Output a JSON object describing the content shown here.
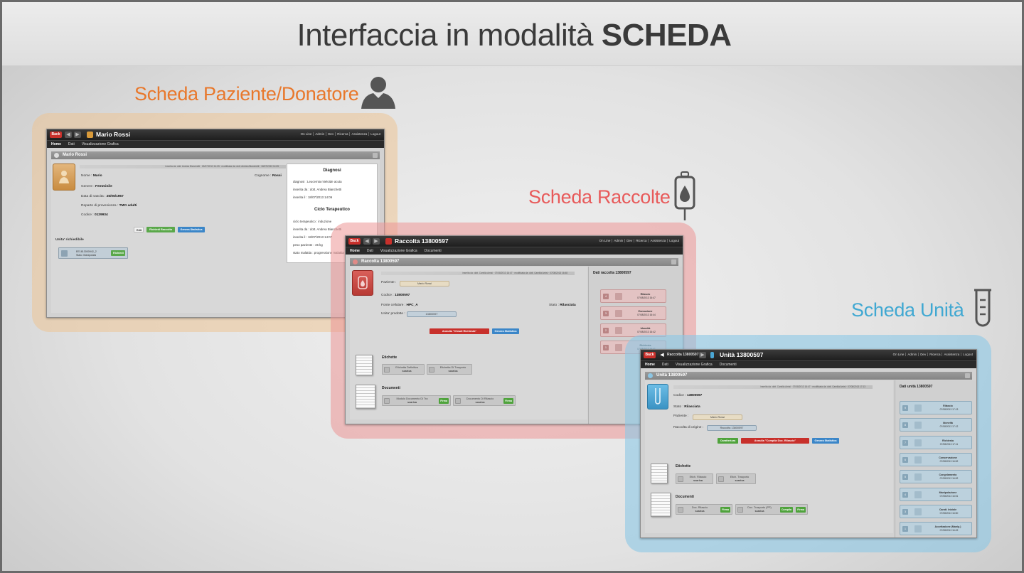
{
  "title": {
    "prefix": "Interfaccia in modalità",
    "bold": "SCHEDA"
  },
  "colors": {
    "paziente": "#e8782c",
    "raccolte": "#e85a5a",
    "unita": "#40a8d2"
  },
  "icons": {
    "paziente": "person-icon",
    "raccolte": "blood-bag-icon",
    "unita": "test-tube-icon"
  },
  "common": {
    "back": "Back",
    "top_menu": [
      "On Line",
      "Admin",
      "Dev",
      "Ricerca",
      "Assistenza",
      "Logout"
    ],
    "tabs": [
      "Home",
      "Dati",
      "Visualizzazione Grafica",
      "Documenti"
    ]
  },
  "paziente": {
    "label": "Scheda Paziente/Donatore",
    "title": "Mario Rossi",
    "header": "Mario Rossi",
    "meta": "inserita da: dott. Andrea Bianchetti · 18/07/2013 14:05 · modificata da: dott. Andrea Bianchetti · 18/07/2013 14:05",
    "nome_label": "Nome :",
    "nome": "Mario",
    "cognome_label": "Cognome :",
    "cognome": "Rossi",
    "genere_label": "Genere :",
    "genere": "Femminile",
    "nascita_label": "Data di nascita :",
    "nascita": "25/06/1967",
    "reparto_label": "Reparto di provenienza :",
    "reparto": "TMO adulti",
    "codice_label": "Codice :",
    "codice": "0129934",
    "btn_edit": "Edit",
    "btn_richiedi": "Richiedi Raccolta",
    "btn_genera": "Genera Statistica",
    "unita_title": "Unita' richiedibile",
    "unita_code": "EE1813000942_2",
    "unita_stato": "Stato: Manipolata",
    "unita_btn": "Richiedi",
    "diagnosi": {
      "title": "Diagnosi",
      "rows": [
        "diagnosi : Leucemia mieloide acuta",
        "inserita da : dott. Andrea Bianchetti",
        "inserita il : 18/07/2013 14:06"
      ]
    },
    "ciclo": {
      "title": "Ciclo Terapeutico",
      "rows": [
        "ciclo terapeutico : induzione",
        "inserita da : dott. Andrea Bianchetti",
        "inserita il : 18/07/2013 14:07",
        "peso paziente : 45 kg",
        "stato malattia : progressione malattia"
      ]
    }
  },
  "raccolte": {
    "label": "Scheda Raccolte",
    "title": "Raccolta 13800597",
    "header": "Raccolta 13800597",
    "meta": "inserita da: dott. Camilla Amisi · 07/08/2013 16:47 · modificata da: dott. Camilla Amisi · 07/08/2013 16:48",
    "paziente_label": "Paziente :",
    "paziente": "Mario Rossi",
    "codice_label": "Codice :",
    "codice": "13800597",
    "fonte_label": "Fonte cellulare :",
    "fonte": "HPC_A",
    "stato_label": "Stato :",
    "stato": "Rilasciata",
    "unita_label": "Unita' prodotte :",
    "unita": "13800597",
    "btn_annulla": "Annulla \"Chiudi Richiesta\"",
    "btn_genera": "Genera Statistica",
    "etichette_title": "Etichette",
    "etichette": [
      {
        "label": "Etichetta Definitiva",
        "action": "scarica"
      },
      {
        "label": "Etichetta Di Trasporto",
        "action": "scarica"
      }
    ],
    "documenti_title": "Documenti",
    "documenti": [
      {
        "label": "Modulo Documento Di Tra",
        "action": "scarica",
        "button": "Firma"
      },
      {
        "label": "Documento Di Rilascio",
        "action": "scarica",
        "button": "Firma"
      }
    ],
    "side_title": "Dati raccolta 13800597",
    "events": [
      {
        "n": "4",
        "title": "Rilascio",
        "date": "07/08/2013 16:47",
        "icon": "release-icon"
      },
      {
        "n": "3",
        "title": "Esecuzione",
        "date": "07/08/2013 16:44",
        "icon": "execution-icon"
      },
      {
        "n": "2",
        "title": "Idoneità",
        "date": "07/08/2013 16:42",
        "icon": "thumbs-up-icon"
      },
      {
        "n": "1",
        "title": "Richiesta",
        "date": "07/08/2013 16:41",
        "icon": "request-icon"
      }
    ]
  },
  "unita": {
    "label": "Scheda Unità",
    "crumb": "Raccolta 13800597",
    "title": "Unità 13800597",
    "header": "Unità 13800597",
    "meta": "inserita da: dott. Camilla Amisi · 07/08/2013 16:47 · modificata da: dott. Camilla Amisi · 07/08/2013 17:13",
    "codice_label": "Codice :",
    "codice": "13800597",
    "stato_label": "Stato :",
    "stato": "Rilasciata",
    "paziente_label": "Paziente :",
    "paziente": "Mario Rossi",
    "origine_label": "Raccolta di origine :",
    "origine": "Raccolta 13800597",
    "btn_car": "Caratterizza",
    "btn_annulla": "Annulla \"Compila Doc. Rilascio\"",
    "btn_genera": "Genera Statistica",
    "etichette_title": "Etichette",
    "etichette": [
      {
        "label": "Etich. Rilascio",
        "action": "scarica"
      },
      {
        "label": "Etich. Trasporto",
        "action": "scarica"
      }
    ],
    "documenti_title": "Documenti",
    "documenti": [
      {
        "label": "Doc. Rilascio",
        "action": "scarica",
        "button": "Firma"
      },
      {
        "label": "Doc. Trasporto (PP)",
        "action": "scarica",
        "button": "Compila",
        "button2": "Firma"
      }
    ],
    "side_title": "Dati unità 13800597",
    "events": [
      {
        "n": "9",
        "title": "Rilascio",
        "date": "07/08/2013 17:13",
        "icon": "release-icon"
      },
      {
        "n": "8",
        "title": "Idoneità",
        "date": "07/08/2013 17:12",
        "icon": "thumbs-up-icon"
      },
      {
        "n": "7",
        "title": "Richiesta",
        "date": "07/08/2013 17:11",
        "icon": "request-icon"
      },
      {
        "n": "6",
        "title": "Conservazione",
        "date": "07/08/2013 16:52",
        "icon": "storage-icon"
      },
      {
        "n": "5",
        "title": "Congelamento",
        "date": "07/08/2013 16:52",
        "icon": "snowflake-icon"
      },
      {
        "n": "4",
        "title": "Manipolazione",
        "date": "07/08/2013 16:51",
        "icon": "manipulation-icon"
      },
      {
        "n": "3",
        "title": "Caratt. Iniziale",
        "date": "07/08/2013 16:50",
        "icon": "test-icon"
      },
      {
        "n": "1",
        "title": "Accettazione (Manip.)",
        "date": "07/08/2013 16:49",
        "icon": "accept-icon"
      }
    ]
  }
}
